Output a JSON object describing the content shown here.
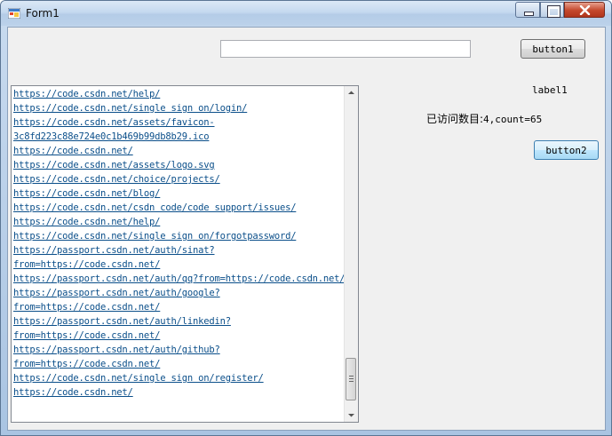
{
  "window": {
    "title": "Form1"
  },
  "textbox": {
    "value": ""
  },
  "buttons": {
    "button1": "button1",
    "button2": "button2"
  },
  "labels": {
    "label1": "label1",
    "count_prefix": "已访问数目:",
    "count_value": "4,count=65"
  },
  "list": {
    "lines": [
      "https://code.csdn.net/help/",
      "https://code.csdn.net/single sign on/login/",
      "https://code.csdn.net/assets/favicon-",
      "3c8fd223c88e724e0c1b469b99db8b29.ico",
      "https://code.csdn.net/",
      "https://code.csdn.net/assets/logo.svg",
      "https://code.csdn.net/choice/projects/",
      "https://code.csdn.net/blog/",
      "https://code.csdn.net/csdn code/code support/issues/",
      "https://code.csdn.net/help/",
      "https://code.csdn.net/single sign on/forgotpassword/",
      "https://passport.csdn.net/auth/sinat?",
      "from=https://code.csdn.net/",
      "https://passport.csdn.net/auth/qq?from=https://code.csdn.net/",
      "https://passport.csdn.net/auth/google?",
      "from=https://code.csdn.net/",
      "https://passport.csdn.net/auth/linkedin?",
      "from=https://code.csdn.net/",
      "https://passport.csdn.net/auth/github?",
      "from=https://code.csdn.net/",
      "https://code.csdn.net/single sign on/register/",
      "https://code.csdn.net/"
    ]
  }
}
